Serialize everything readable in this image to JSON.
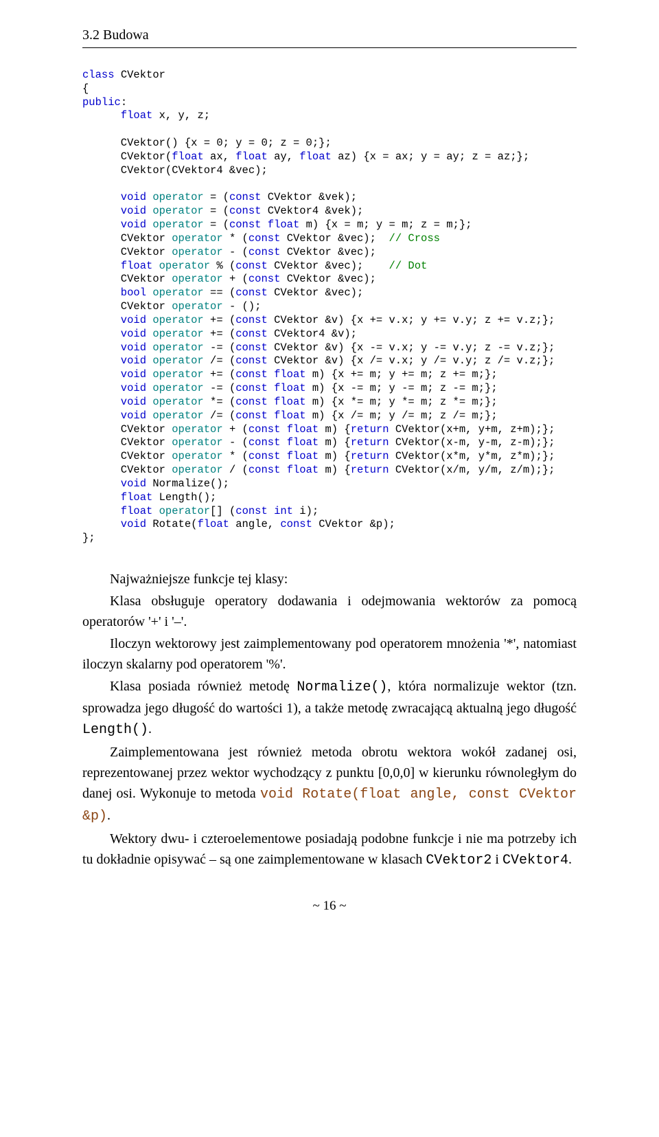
{
  "heading": "3.2 Budowa",
  "code": {
    "l01a": "class",
    "l01b": " CVektor",
    "l02": "{",
    "l03a": "public",
    "l03b": ":",
    "l04a": "      float",
    "l04b": " x, y, z;",
    "l05": "",
    "l06a": "      CVektor() {x = 0; y = 0; z = 0;};",
    "l07a": "      CVektor(",
    "l07b": "float",
    "l07c": " ax, ",
    "l07d": "float",
    "l07e": " ay, ",
    "l07f": "float",
    "l07g": " az) {x = ax; y = ay; z = az;};",
    "l08a": "      CVektor(CVektor4 &vec);",
    "l09": "",
    "l10a": "      void",
    "l10b": " operator",
    "l10c": " = (",
    "l10d": "const",
    "l10e": " CVektor &vek);",
    "l11a": "      void",
    "l11b": " operator",
    "l11c": " = (",
    "l11d": "const",
    "l11e": " CVektor4 &vek);",
    "l12a": "      void",
    "l12b": " operator",
    "l12c": " = (",
    "l12d": "const",
    "l12e": " float",
    "l12f": " m) {x = m; y = m; z = m;};",
    "l13a": "      CVektor ",
    "l13b": "operator",
    "l13c": " * (",
    "l13d": "const",
    "l13e": " CVektor &vec);  ",
    "l13f": "// Cross",
    "l14a": "      CVektor ",
    "l14b": "operator",
    "l14c": " - (",
    "l14d": "const",
    "l14e": " CVektor &vec);",
    "l15a": "      float",
    "l15b": " operator",
    "l15c": " % (",
    "l15d": "const",
    "l15e": " CVektor &vec);    ",
    "l15f": "// Dot",
    "l16a": "      CVektor ",
    "l16b": "operator",
    "l16c": " + (",
    "l16d": "const",
    "l16e": " CVektor &vec);",
    "l17a": "      bool",
    "l17b": " operator",
    "l17c": " == (",
    "l17d": "const",
    "l17e": " CVektor &vec);",
    "l18a": "      CVektor ",
    "l18b": "operator",
    "l18c": " - ();",
    "l19a": "      void",
    "l19b": " operator",
    "l19c": " += (",
    "l19d": "const",
    "l19e": " CVektor &v) {x += v.x; y += v.y; z += v.z;};",
    "l20a": "      void",
    "l20b": " operator",
    "l20c": " += (",
    "l20d": "const",
    "l20e": " CVektor4 &v);",
    "l21a": "      void",
    "l21b": " operator",
    "l21c": " -= (",
    "l21d": "const",
    "l21e": " CVektor &v) {x -= v.x; y -= v.y; z -= v.z;};",
    "l22a": "      void",
    "l22b": " operator",
    "l22c": " /= (",
    "l22d": "const",
    "l22e": " CVektor &v) {x /= v.x; y /= v.y; z /= v.z;};",
    "l23a": "      void",
    "l23b": " operator",
    "l23c": " += (",
    "l23d": "const",
    "l23e": " float",
    "l23f": " m) {x += m; y += m; z += m;};",
    "l24a": "      void",
    "l24b": " operator",
    "l24c": " -= (",
    "l24d": "const",
    "l24e": " float",
    "l24f": " m) {x -= m; y -= m; z -= m;};",
    "l25a": "      void",
    "l25b": " operator",
    "l25c": " *= (",
    "l25d": "const",
    "l25e": " float",
    "l25f": " m) {x *= m; y *= m; z *= m;};",
    "l26a": "      void",
    "l26b": " operator",
    "l26c": " /= (",
    "l26d": "const",
    "l26e": " float",
    "l26f": " m) {x /= m; y /= m; z /= m;};",
    "l27a": "      CVektor ",
    "l27b": "operator",
    "l27c": " + (",
    "l27d": "const",
    "l27e": " float",
    "l27f": " m) {",
    "l27g": "return",
    "l27h": " CVektor(x+m, y+m, z+m);};",
    "l28a": "      CVektor ",
    "l28b": "operator",
    "l28c": " - (",
    "l28d": "const",
    "l28e": " float",
    "l28f": " m) {",
    "l28g": "return",
    "l28h": " CVektor(x-m, y-m, z-m);};",
    "l29a": "      CVektor ",
    "l29b": "operator",
    "l29c": " * (",
    "l29d": "const",
    "l29e": " float",
    "l29f": " m) {",
    "l29g": "return",
    "l29h": " CVektor(x*m, y*m, z*m);};",
    "l30a": "      CVektor ",
    "l30b": "operator",
    "l30c": " / (",
    "l30d": "const",
    "l30e": " float",
    "l30f": " m) {",
    "l30g": "return",
    "l30h": " CVektor(x/m, y/m, z/m);};",
    "l31a": "      void",
    "l31b": " Normalize();",
    "l32a": "      float",
    "l32b": " Length();",
    "l33a": "      float",
    "l33b": " operator",
    "l33c": "[] (",
    "l33d": "const",
    "l33e": " int",
    "l33f": " i);",
    "l34a": "      void",
    "l34b": " Rotate(",
    "l34c": "float",
    "l34d": " angle, ",
    "l34e": "const",
    "l34f": " CVektor &p);",
    "l35": "};"
  },
  "para1a": "Najważniejsze funkcje tej klasy:",
  "para1b": "Klasa obsługuje operatory dodawania i odejmowania wektorów za pomocą operatorów '+' i '–'.",
  "para2": "Iloczyn wektorowy jest zaimplementowany pod operatorem mnożenia '*', natomiast iloczyn skalarny pod operatorem '%'.",
  "para3a": "Klasa posiada również metodę ",
  "para3code": "Normalize()",
  "para3b": ", która normalizuje wektor (tzn. sprowadza jego długość do wartości 1), a także metodę zwracającą aktualną jego długość ",
  "para3code2": "Length()",
  "para3c": ".",
  "para4a": "Zaimplementowana jest również metoda obrotu wektora wokół zadanej osi, reprezentowanej przez wektor wychodzący z punktu [0,0,0] w kierunku równoległym do danej osi. Wykonuje to metoda ",
  "para4code": "void Rotate(float angle, const CVektor &p)",
  "para4b": ".",
  "para5a": "Wektory dwu- i czteroelementowe posiadają podobne funkcje i nie ma potrzeby ich tu dokładnie opisywać – są one zaimplementowane w klasach ",
  "para5code1": "CVektor2",
  "para5b": " i ",
  "para5code2": "CVektor4",
  "para5c": ".",
  "pagenum": "~ 16 ~"
}
